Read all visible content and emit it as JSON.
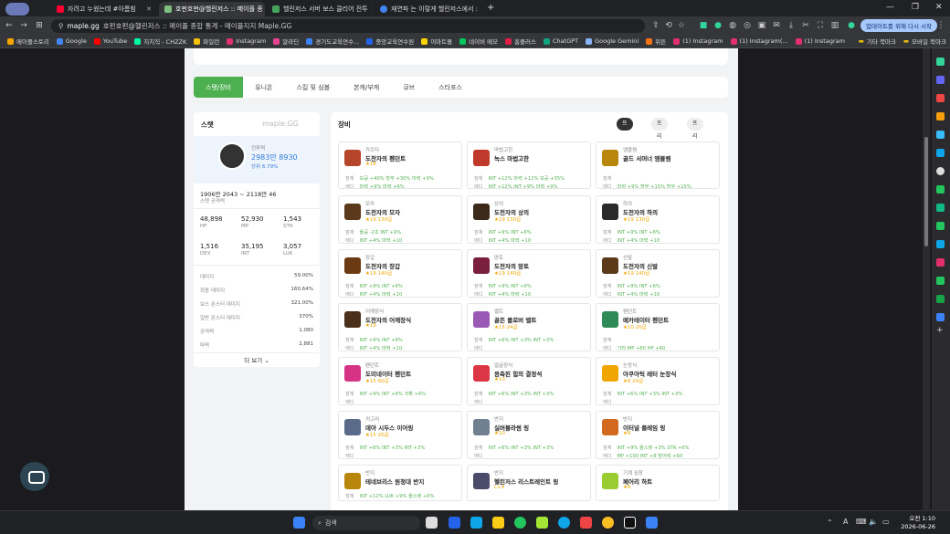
{
  "tabs": [
    {
      "label": "자려고 누웠는데 #아름힘",
      "color": "#ff0033"
    },
    {
      "label": "호펀호펀@헬린저스 :: 메이플 종",
      "color": "#7fbf7f"
    },
    {
      "label": "헬린저스 서버 보스 클리어 전투",
      "color": "#46a35e"
    },
    {
      "label": "재연파 는 이렇게 헬린저스에서 :",
      "color": "#4285f4"
    }
  ],
  "url": {
    "host": "maple.gg",
    "path": "호펀호펀@헬린저스 :: 메이플 종합 통계 - 메이플지지 Maple.GG"
  },
  "update_btn": "업데이트를 위해 다시 시작",
  "bookmarks": [
    {
      "label": "메이플스토리",
      "color": "#f7a600"
    },
    {
      "label": "Google",
      "color": "#4285f4"
    },
    {
      "label": "YouTube",
      "color": "#ff0000"
    },
    {
      "label": "치지직 - CHZZK",
      "color": "#00ffa3"
    },
    {
      "label": "파일런",
      "color": "#f4c20d"
    },
    {
      "label": "Instagram",
      "color": "#e1306c"
    },
    {
      "label": "알라딘",
      "color": "#e84393"
    },
    {
      "label": "경기도교육연수...",
      "color": "#3b82f6"
    },
    {
      "label": "중앙교육연수원",
      "color": "#2563eb"
    },
    {
      "label": "이마트몰",
      "color": "#ffd400"
    },
    {
      "label": "네이버 메모",
      "color": "#03c75a"
    },
    {
      "label": "홈플러스",
      "color": "#e11d48"
    },
    {
      "label": "ChatGPT",
      "color": "#10a37f"
    },
    {
      "label": "Google Gemini",
      "color": "#8ab4f8"
    },
    {
      "label": "위튼",
      "color": "#f97316"
    },
    {
      "label": "(1) Instagram",
      "color": "#e1306c"
    },
    {
      "label": "(1) Instagram(...",
      "color": "#e1306c"
    },
    {
      "label": "(1) Instagram",
      "color": "#e1306c"
    }
  ],
  "bookmarks_right": [
    "기타 북마크",
    "모바일 북마크"
  ],
  "nav_tabs": [
    "스탯/장비",
    "유니온",
    "스킬 및 심볼",
    "본캐/부캐",
    "큐브",
    "스타포스"
  ],
  "stat": {
    "title": "스탯",
    "logo": "maple.GG",
    "power_label": "전투력",
    "power": "2983만 8930",
    "power_rank": "상위 6.79%",
    "range": "1906만 2043 ~ 2118만 46",
    "range_label": "스탯 공격력",
    "main": [
      {
        "v": "48,898",
        "k": "HP"
      },
      {
        "v": "52,930",
        "k": "MP"
      },
      {
        "v": "1,543",
        "k": "STR"
      },
      {
        "v": "1,516",
        "k": "DEX"
      },
      {
        "v": "35,195",
        "k": "INT"
      },
      {
        "v": "3,057",
        "k": "LUK"
      }
    ],
    "details": [
      {
        "k": "데미지",
        "v": "59.00%"
      },
      {
        "k": "최종 데미지",
        "v": "160.64%"
      },
      {
        "k": "보스 몬스터 데미지",
        "v": "321.00%"
      },
      {
        "k": "일반 몬스터 데미지",
        "v": "370%"
      },
      {
        "k": "공격력",
        "v": "1,080"
      },
      {
        "k": "마력",
        "v": "2,881"
      }
    ],
    "more": "더 보기"
  },
  "equip": {
    "title": "장비",
    "presets": [
      "프리셋 1",
      "프리셋 2",
      "프리셋 3"
    ],
    "items": [
      {
        "slot": "카르타",
        "name": "도전자의 펜던트",
        "meta": "★18",
        "color": "#b5462a",
        "l1": "보공 +40%  방무 +30%  마력 +9%",
        "l2": "마력 +9%  마력 +6%"
      },
      {
        "slot": "마법고한",
        "name": "녹스 마법고한",
        "meta": "",
        "color": "#c0392b",
        "l1": "INT +12%  마력 +12%  보공 +35%",
        "l2": "INT +12%  INT +9%  마력 +9%"
      },
      {
        "slot": "엠블렘",
        "name": "골드 서머너 엠블렘",
        "meta": "",
        "color": "#b8860b",
        "l1": "",
        "l2": "마력 +9%  방무 +15%  방무 +15%"
      },
      {
        "slot": "모자",
        "name": "도전자의 모자",
        "meta": "★19  130급",
        "color": "#5a3a1a",
        "l1": "올공 -2초  INT +9%",
        "l2": "INT +4%  마력 +10"
      },
      {
        "slot": "상의",
        "name": "도전자의 상의",
        "meta": "★19  130급",
        "color": "#3b2a1a",
        "l1": "INT +9%  INT +6%",
        "l2": "INT +4%  마력 +10"
      },
      {
        "slot": "하의",
        "name": "도전자의 하의",
        "meta": "★19  130급",
        "color": "#2a2a2a",
        "l1": "INT +9%  INT +6%",
        "l2": "INT +4%  마력 +10"
      },
      {
        "slot": "장갑",
        "name": "도전자의 장갑",
        "meta": "★19  140급",
        "color": "#6b3a12",
        "l1": "INT +9%  INT +6%",
        "l2": "INT +4%  마력 +10"
      },
      {
        "slot": "망토",
        "name": "도전자의 망토",
        "meta": "★19  140급",
        "color": "#7a1f3d",
        "l1": "INT +9%  INT +6%",
        "l2": "INT +4%  마력 +10"
      },
      {
        "slot": "신발",
        "name": "도전자의 신발",
        "meta": "★19  140급",
        "color": "#5b3a1a",
        "l1": "INT +9%  INT +6%",
        "l2": "INT +4%  마력 +10"
      },
      {
        "slot": "어깨장식",
        "name": "도전자의 어깨장식",
        "meta": "★19",
        "color": "#4a2f1a",
        "l1": "INT +9%  INT +6%",
        "l2": "INT +4%  마력 +10"
      },
      {
        "slot": "벨트",
        "name": "골든 클로버 벨트",
        "meta": "★15  24급",
        "color": "#9b59b6",
        "l1": "INT +6%  INT +3%  INT +3%",
        "l2": ""
      },
      {
        "slot": "펜던트",
        "name": "메카테이터 펜던트",
        "meta": "★10  20급",
        "color": "#2e8b57",
        "l1": "",
        "l2": "기타  MP +60  HP +60"
      },
      {
        "slot": "펜던트",
        "name": "도미네이터 펜던트",
        "meta": "★15  60급",
        "color": "#d63384",
        "l1": "INT +9%  INT +6%  크확 +6%",
        "l2": ""
      },
      {
        "slot": "얼굴장식",
        "name": "응축된 힘의 결정석",
        "meta": "★10",
        "color": "#dc3545",
        "l1": "INT +6%  INT +3%  INT +3%",
        "l2": ""
      },
      {
        "slot": "눈장식",
        "name": "아쿠아틱 레터 눈장식",
        "meta": "★8  24급",
        "color": "#f0a500",
        "l1": "INT +6%  INT +3%  INT +3%",
        "l2": ""
      },
      {
        "slot": "귀고리",
        "name": "데아 시두스 이어링",
        "meta": "★15  20급",
        "color": "#5a6b8a",
        "l1": "INT +6%  INT +3%  INT +3%",
        "l2": ""
      },
      {
        "slot": "반지",
        "name": "실버블라썸 링",
        "meta": "★10",
        "color": "#708090",
        "l1": "INT +6%  INT +3%  INT +3%",
        "l2": ""
      },
      {
        "slot": "반지",
        "name": "이터널 플레임 링",
        "meta": "★8",
        "color": "#d2691e",
        "l1": "INT +9%  올스탯 +3%  STR +6%",
        "l2": "MP +100  INT +8  방어력 +60"
      },
      {
        "slot": "반지",
        "name": "테네브리스 원정대 반지",
        "meta": "",
        "color": "#b8860b",
        "l1": "INT +12%  LUK +9%  올스탯 +6%",
        "l2": "마력 +10  방어력 +60  INT +4"
      },
      {
        "slot": "반지",
        "name": "헬린저스 리스트레인트 링",
        "meta": "Lv.4",
        "color": "#4a4a6a",
        "l1": "",
        "l2": ""
      },
      {
        "slot": "기계 심장",
        "name": "페어리 하트",
        "meta": "★8",
        "color": "#9acd32",
        "l1": "",
        "l2": ""
      }
    ]
  },
  "taskbar": {
    "search": "검색",
    "time": "오전 1:10",
    "date": "2026-06-26"
  }
}
